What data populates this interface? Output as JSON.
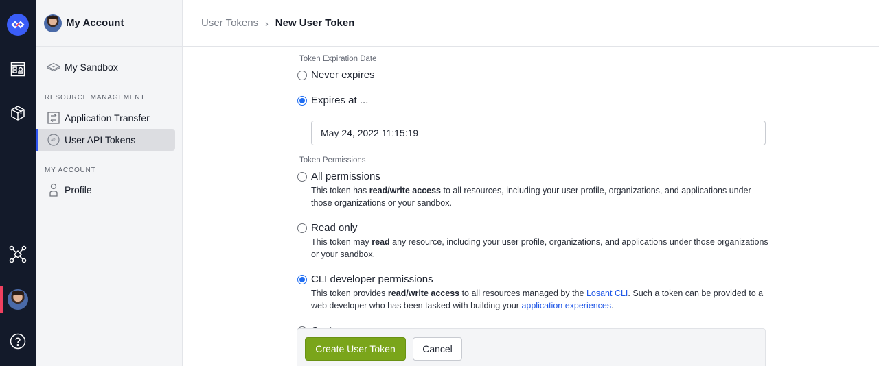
{
  "rail": {
    "items": [
      {
        "name": "logo",
        "icon": "losant-logo-icon"
      },
      {
        "name": "dashboards",
        "icon": "dashboard-icon"
      },
      {
        "name": "applications",
        "icon": "box-icon"
      },
      {
        "name": "organizations",
        "icon": "network-icon"
      },
      {
        "name": "account",
        "icon": "avatar"
      },
      {
        "name": "help",
        "icon": "help-icon"
      }
    ],
    "colors": {
      "background": "#131a2a",
      "logo": "#3a5df7",
      "active_indicator": "#f0405f"
    }
  },
  "sidebar": {
    "title": "My Account",
    "sandbox_label": "My Sandbox",
    "sections": [
      {
        "heading": "RESOURCE MANAGEMENT",
        "items": [
          {
            "label": "Application Transfer",
            "icon": "transfer-icon",
            "active": false
          },
          {
            "label": "User API Tokens",
            "icon": "api-icon",
            "active": true
          }
        ]
      },
      {
        "heading": "MY ACCOUNT",
        "items": [
          {
            "label": "Profile",
            "icon": "user-icon",
            "active": false
          }
        ]
      }
    ]
  },
  "breadcrumb": {
    "parent": "User Tokens",
    "separator": "›",
    "current": "New User Token"
  },
  "form": {
    "expiration": {
      "label": "Token Expiration Date",
      "options": [
        {
          "label": "Never expires",
          "checked": false
        },
        {
          "label": "Expires at ...",
          "checked": true
        }
      ],
      "date_value": "May 24, 2022 11:15:19"
    },
    "permissions": {
      "label": "Token Permissions",
      "options": [
        {
          "label": "All permissions",
          "checked": false,
          "desc_pre": "This token has ",
          "desc_bold": "read/write access",
          "desc_post": " to all resources, including your user profile, organizations, and applications under those organizations or your sandbox."
        },
        {
          "label": "Read only",
          "checked": false,
          "desc_pre": "This token may ",
          "desc_bold": "read",
          "desc_post": " any resource, including your user profile, organizations, and applications under those organizations or your sandbox."
        },
        {
          "label": "CLI developer permissions",
          "checked": true,
          "desc_pre": "This token provides ",
          "desc_bold": "read/write access",
          "desc_mid": " to all resources managed by the ",
          "desc_link1": "Losant CLI",
          "desc_mid2": ". Such a token can be provided to a web developer who has been tasked with building your ",
          "desc_link2": "application experiences",
          "desc_end": "."
        },
        {
          "label": "Custom",
          "checked": false
        }
      ]
    }
  },
  "footer": {
    "primary_label": "Create User Token",
    "secondary_label": "Cancel",
    "primary_color": "#7aa51a"
  },
  "colors": {
    "accent_blue": "#1f6df2",
    "link": "#1e56e6",
    "active_nav": "#2f55f0"
  }
}
